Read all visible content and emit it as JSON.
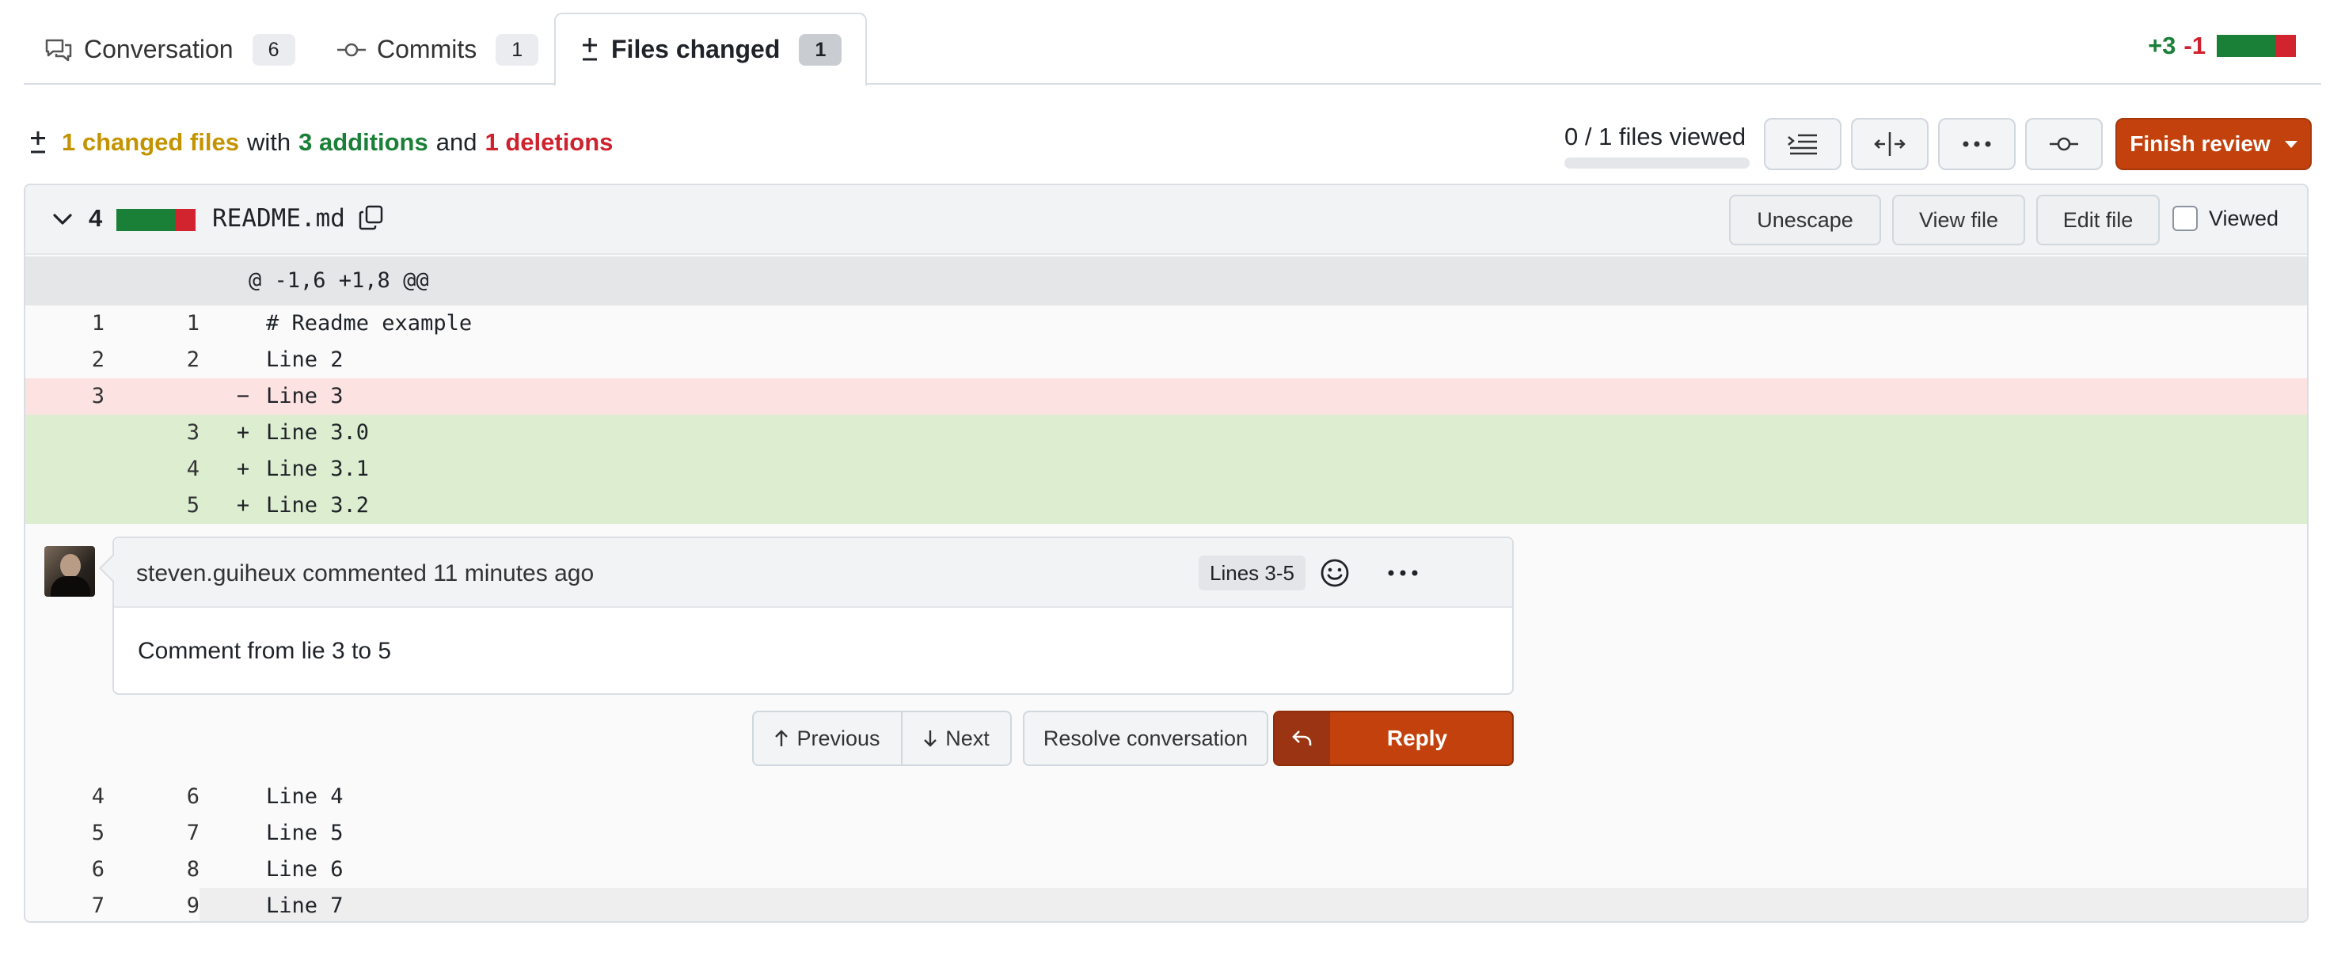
{
  "tabs": [
    {
      "label": "Conversation",
      "count": "6"
    },
    {
      "label": "Commits",
      "count": "1"
    },
    {
      "label": "Files changed",
      "count": "1"
    }
  ],
  "diffstat": {
    "additions": "+3",
    "deletions": "-1"
  },
  "summary": {
    "changed": "1 changed files",
    "with": "with",
    "additions": "3 additions",
    "and": "and",
    "deletions": "1 deletions"
  },
  "files_viewed": {
    "label": "0 / 1 files viewed",
    "progress": 0
  },
  "finish_review": "Finish review",
  "file": {
    "count": "4",
    "name": "README.md",
    "buttons": {
      "unescape": "Unescape",
      "view": "View file",
      "edit": "Edit file"
    },
    "viewed_label": "Viewed"
  },
  "hunk_header": "@ -1,6 +1,8 @@",
  "lines_top": [
    {
      "old": "1",
      "new": "1",
      "sign": "",
      "code": "# Readme example",
      "type": "ctx"
    },
    {
      "old": "2",
      "new": "2",
      "sign": "",
      "code": "Line 2",
      "type": "ctx"
    },
    {
      "old": "3",
      "new": "",
      "sign": "−",
      "code": "Line 3",
      "type": "del"
    },
    {
      "old": "",
      "new": "3",
      "sign": "+",
      "code": "Line 3.0",
      "type": "add"
    },
    {
      "old": "",
      "new": "4",
      "sign": "+",
      "code": "Line 3.1",
      "type": "add"
    },
    {
      "old": "",
      "new": "5",
      "sign": "+",
      "code": "Line 3.2",
      "type": "add"
    }
  ],
  "comment": {
    "author_line": "steven.guiheux commented 11 minutes ago",
    "lines_badge": "Lines 3-5",
    "body": "Comment from lie 3 to 5"
  },
  "comment_actions": {
    "previous": "Previous",
    "next": "Next",
    "resolve": "Resolve conversation",
    "reply": "Reply"
  },
  "lines_bottom": [
    {
      "old": "4",
      "new": "6",
      "code": "Line 4"
    },
    {
      "old": "5",
      "new": "7",
      "code": "Line 5"
    },
    {
      "old": "6",
      "new": "8",
      "code": "Line 6"
    },
    {
      "old": "7",
      "new": "9",
      "code": "Line 7"
    }
  ]
}
